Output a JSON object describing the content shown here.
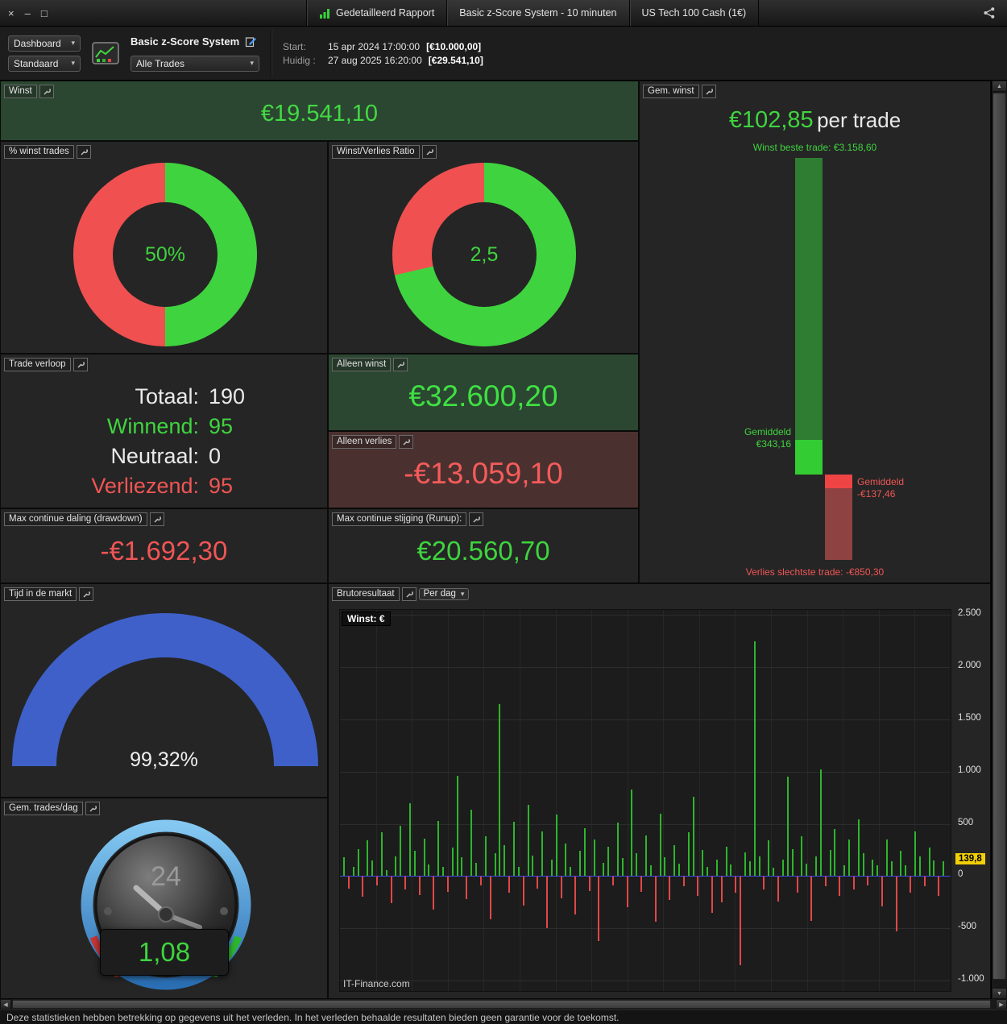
{
  "icons": {
    "close": "×",
    "minimize": "–",
    "maximize": "□",
    "caret": "▾",
    "scroll_up": "▲",
    "scroll_down": "▼",
    "scroll_left": "◀",
    "scroll_right": "▶"
  },
  "colors": {
    "green": "#3fd43f",
    "red": "#f05555",
    "dark_green_bg": "#2b4731",
    "dark_red_bg": "#4a312f",
    "gauge_blue": "#3e60c8",
    "badge_yellow": "#f2cf06",
    "bar_green": "#2db52d",
    "bar_red": "#e04848"
  },
  "titlebar": {
    "tabs": [
      {
        "label": "Gedetailleerd Rapport"
      },
      {
        "label": "Basic z-Score System - 10 minuten"
      },
      {
        "label": "US Tech 100 Cash (1€)"
      }
    ]
  },
  "toolbar": {
    "dashboard_select": "Dashboard",
    "layout_select": "Standaard",
    "system_name": "Basic z-Score System",
    "trades_select": "Alle Trades",
    "start_label": "Start:",
    "start_datetime": "15 apr 2024 17:00:00",
    "start_amount": "[€10.000,00]",
    "current_label": "Huidig :",
    "current_datetime": "27 aug 2025 16:20:00",
    "current_amount": "[€29.541,10]"
  },
  "panels": {
    "winst": {
      "title": "Winst",
      "value": "€19.541,10"
    },
    "gem_winst": {
      "title": "Gem. winst",
      "headline_value": "€102,85",
      "headline_suffix": "per trade",
      "best_label": "Winst beste trade: €3.158,60",
      "avg_win_line1": "Gemiddeld",
      "avg_win_line2": "€343,16",
      "avg_loss_line1": "Gemiddeld",
      "avg_loss_line2": "-€137,46",
      "worst_label": "Verlies slechtste trade: -€850,30"
    },
    "pct_winst": {
      "title": "% winst trades",
      "center_label": "50%"
    },
    "ratio": {
      "title": "Winst/Verlies Ratio",
      "center_label": "2,5"
    },
    "trade_verloop": {
      "title": "Trade verloop",
      "rows": [
        {
          "label": "Totaal:",
          "value": "190"
        },
        {
          "label": "Winnend:",
          "value": "95"
        },
        {
          "label": "Neutraal:",
          "value": "0"
        },
        {
          "label": "Verliezend:",
          "value": "95"
        }
      ]
    },
    "alleen_winst": {
      "title": "Alleen winst",
      "value": "€32.600,20"
    },
    "alleen_verlies": {
      "title": "Alleen verlies",
      "value": "-€13.059,10"
    },
    "drawdown": {
      "title": "Max continue daling (drawdown)",
      "value": "-€1.692,30"
    },
    "runup": {
      "title": "Max continue stijging (Runup):",
      "value": "€20.560,70"
    },
    "tijd": {
      "title": "Tijd in de markt",
      "value": "99,32%"
    },
    "trades_dag": {
      "title": "Gem. trades/dag",
      "value": "1,08",
      "clock_label": "24"
    },
    "bruto": {
      "title": "Brutoresultaat",
      "per_select": "Per dag",
      "plot_label": "Winst: €",
      "watermark": "IT-Finance.com"
    }
  },
  "statusbar": {
    "text": "Deze statistieken hebben betrekking op gegevens uit het verleden. In het verleden behaalde resultaten bieden geen garantie voor de toekomst."
  },
  "chart_data": [
    {
      "id": "pct_winst",
      "type": "pie",
      "title": "% winst trades",
      "labels": [
        "winnend",
        "verliezend"
      ],
      "values": [
        50,
        50
      ],
      "center_label": "50%",
      "colors": [
        "#3fd43f",
        "#f05050"
      ]
    },
    {
      "id": "ratio",
      "type": "pie",
      "title": "Winst/Verlies Ratio",
      "labels": [
        "winst",
        "verlies"
      ],
      "values": [
        71.4,
        28.6
      ],
      "ratio": 2.5,
      "center_label": "2,5",
      "colors": [
        "#3fd43f",
        "#f05050"
      ]
    },
    {
      "id": "tijd",
      "type": "gauge",
      "title": "Tijd in de markt",
      "value_pct": 99.32,
      "color": "#3e60c8"
    },
    {
      "id": "gem_winst",
      "type": "bar",
      "title": "Gem. winst per trade",
      "avg_per_trade": 102.85,
      "best_trade": 3158.6,
      "avg_win": 343.16,
      "avg_loss": -137.46,
      "worst_trade": -850.3
    },
    {
      "id": "daily",
      "type": "bar",
      "title": "Brutoresultaat per dag",
      "ylabel": "Winst: €",
      "ylim": [
        -1100,
        2550
      ],
      "yticks": [
        {
          "v": 2500,
          "label": "2.500"
        },
        {
          "v": 2000,
          "label": "2.000"
        },
        {
          "v": 1500,
          "label": "1.500"
        },
        {
          "v": 1000,
          "label": "1.000"
        },
        {
          "v": 500,
          "label": "500"
        },
        {
          "v": 0,
          "label": "0"
        },
        {
          "v": -500,
          "label": "-500"
        },
        {
          "v": -1000,
          "label": "-1.000"
        }
      ],
      "badge": {
        "v": 139.8,
        "label": "139,8"
      },
      "bar_colors": {
        "pos": "#2db52d",
        "neg": "#e04848"
      },
      "zero_line_color": "#4646e8",
      "values": [
        180,
        -120,
        90,
        260,
        -200,
        340,
        150,
        -90,
        420,
        60,
        -260,
        190,
        480,
        -130,
        700,
        240,
        -180,
        360,
        110,
        -320,
        530,
        90,
        -150,
        270,
        960,
        180,
        -220,
        640,
        130,
        -90,
        380,
        -410,
        220,
        1650,
        300,
        -160,
        520,
        90,
        -280,
        680,
        200,
        -120,
        430,
        -500,
        160,
        590,
        -210,
        310,
        90,
        -370,
        240,
        460,
        -140,
        350,
        -620,
        130,
        280,
        -90,
        510,
        170,
        -300,
        830,
        220,
        -150,
        390,
        100,
        -440,
        600,
        180,
        -230,
        300,
        120,
        -100,
        420,
        760,
        -190,
        250,
        90,
        -350,
        160,
        -250,
        280,
        110,
        -160,
        -850,
        230,
        140,
        2250,
        190,
        -130,
        340,
        80,
        -240,
        160,
        950,
        260,
        -160,
        380,
        120,
        -430,
        190,
        1020,
        -100,
        250,
        450,
        -190,
        100,
        350,
        -130,
        540,
        220,
        -90,
        160,
        100,
        -290,
        350,
        140,
        -530,
        240,
        100,
        -160,
        430,
        190,
        -100,
        270,
        150,
        -190,
        140
      ]
    }
  ]
}
